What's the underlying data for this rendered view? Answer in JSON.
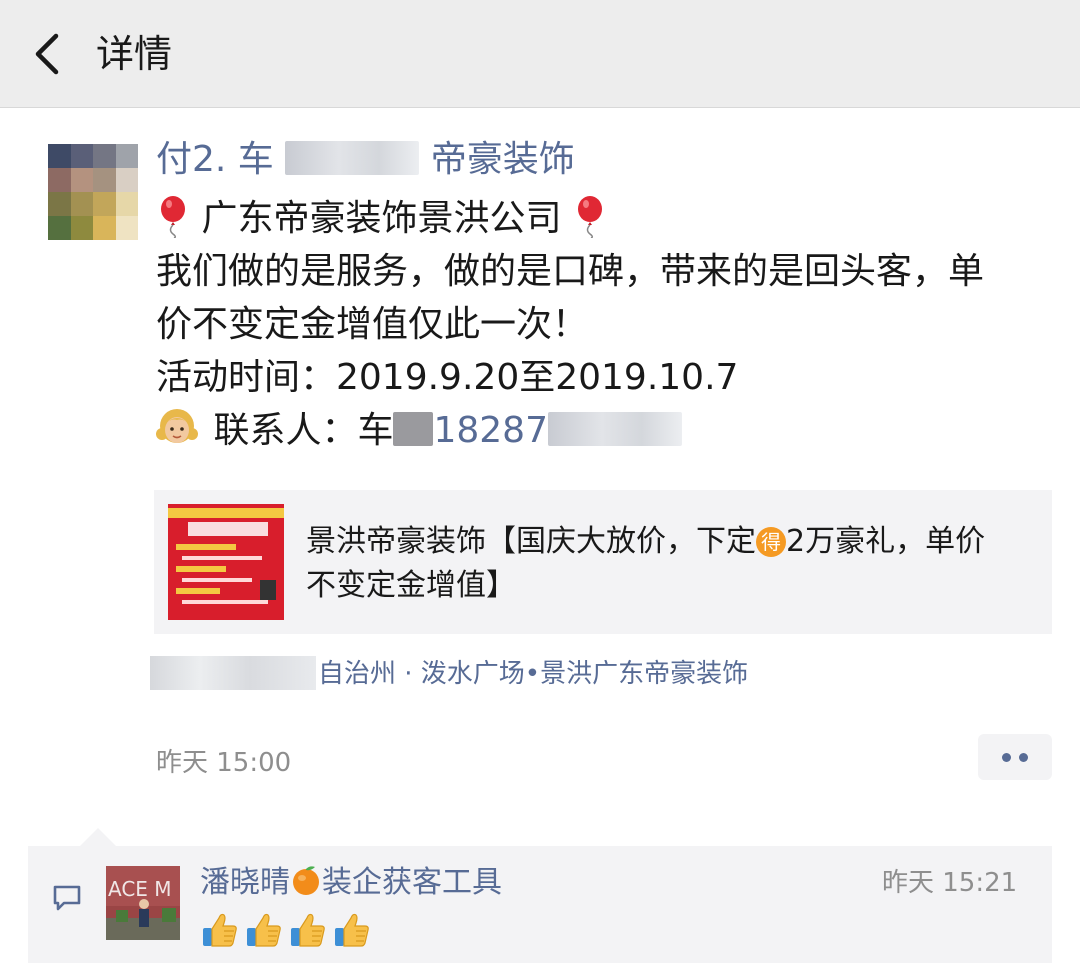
{
  "navbar": {
    "title": "详情"
  },
  "post": {
    "author_prefix": "付2. 车",
    "author_suffix": "帝豪装饰",
    "content": {
      "line1_text": "广东帝豪装饰景洪公司",
      "line2": "我们做的是服务，做的是口碑，带来的是回头客，单",
      "line3": "价不变定金增值仅此一次！",
      "line4": "活动时间：2019.9.20至2019.10.7",
      "contact_label": "联系人：车",
      "contact_phone_visible": "18287"
    },
    "link_card": {
      "title_part1": "景洪帝豪装饰【国庆大放价，下定",
      "badge": "得",
      "title_part2": "2万豪礼，单价",
      "title_line2": "不变定金增值】"
    },
    "location": {
      "visible_text": "自治州 · 泼水广场•景洪广东帝豪装饰"
    },
    "timestamp": "昨天 15:00"
  },
  "comment": {
    "name": "潘晓晴",
    "name_suffix": "装企获客工具",
    "time": "昨天 15:21",
    "thumbs_count": 4
  },
  "colors": {
    "link_blue": "#576b95",
    "navbar_bg": "#ededed",
    "card_bg": "#f3f3f5",
    "secondary_text": "#8e8e8e"
  },
  "icons": {
    "back": "back-chevron-icon",
    "balloon": "red-balloon-icon",
    "girl": "girl-emoji-icon",
    "more": "more-dots-icon",
    "comment": "comment-icon",
    "orange": "tangerine-icon",
    "thumbs": "thumbs-up-icon"
  }
}
